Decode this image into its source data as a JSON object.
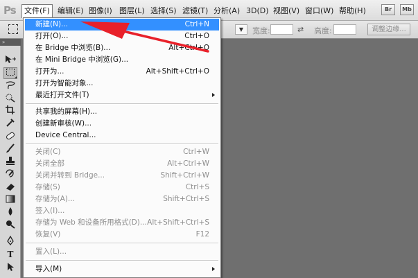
{
  "app": {
    "logo": "Ps"
  },
  "menubar": {
    "items": [
      {
        "label": "文件(F)"
      },
      {
        "label": "编辑(E)"
      },
      {
        "label": "图像(I)"
      },
      {
        "label": "图层(L)"
      },
      {
        "label": "选择(S)"
      },
      {
        "label": "滤镜(T)"
      },
      {
        "label": "分析(A)"
      },
      {
        "label": "3D(D)"
      },
      {
        "label": "视图(V)"
      },
      {
        "label": "窗口(W)"
      },
      {
        "label": "帮助(H)"
      }
    ],
    "bridge_button": "Br",
    "minibridge_button": "Mb"
  },
  "options_bar": {
    "width_label": "宽度:",
    "height_label": "高度:",
    "refine_edge_label": "调整边缘..."
  },
  "file_menu": {
    "groups": [
      [
        {
          "label": "新建(N)...",
          "shortcut": "Ctrl+N",
          "highlighted": true
        },
        {
          "label": "打开(O)...",
          "shortcut": "Ctrl+O"
        },
        {
          "label": "在 Bridge 中浏览(B)...",
          "shortcut": "Alt+Ctrl+O"
        },
        {
          "label": "在 Mini Bridge 中浏览(G)...",
          "shortcut": ""
        },
        {
          "label": "打开为...",
          "shortcut": "Alt+Shift+Ctrl+O"
        },
        {
          "label": "打开为智能对象...",
          "shortcut": ""
        },
        {
          "label": "最近打开文件(T)",
          "shortcut": "",
          "submenu": true
        }
      ],
      [
        {
          "label": "共享我的屏幕(H)...",
          "shortcut": ""
        },
        {
          "label": "创建新审核(W)...",
          "shortcut": ""
        },
        {
          "label": "Device Central...",
          "shortcut": ""
        }
      ],
      [
        {
          "label": "关闭(C)",
          "shortcut": "Ctrl+W",
          "disabled": true
        },
        {
          "label": "关闭全部",
          "shortcut": "Alt+Ctrl+W",
          "disabled": true
        },
        {
          "label": "关闭并转到 Bridge...",
          "shortcut": "Shift+Ctrl+W",
          "disabled": true
        },
        {
          "label": "存储(S)",
          "shortcut": "Ctrl+S",
          "disabled": true
        },
        {
          "label": "存储为(A)...",
          "shortcut": "Shift+Ctrl+S",
          "disabled": true
        },
        {
          "label": "签入(I)...",
          "shortcut": "",
          "disabled": true
        },
        {
          "label": "存储为 Web 和设备所用格式(D)...",
          "shortcut": "Alt+Shift+Ctrl+S",
          "disabled": true
        },
        {
          "label": "恢复(V)",
          "shortcut": "F12",
          "disabled": true
        }
      ],
      [
        {
          "label": "置入(L)...",
          "shortcut": "",
          "disabled": true
        }
      ],
      [
        {
          "label": "导入(M)",
          "shortcut": "",
          "submenu": true
        }
      ]
    ]
  },
  "annotation": {
    "arrow_color": "#e8212a"
  },
  "toolbar": {
    "tools": [
      {
        "name": "move-tool-icon"
      },
      {
        "name": "rectangular-marquee-tool-icon",
        "selected": true
      },
      {
        "name": "lasso-tool-icon"
      },
      {
        "name": "quick-selection-tool-icon"
      },
      {
        "name": "crop-tool-icon"
      },
      {
        "name": "eyedropper-tool-icon"
      },
      {
        "name": "spot-healing-brush-icon"
      },
      {
        "name": "brush-tool-icon"
      },
      {
        "name": "clone-stamp-tool-icon"
      },
      {
        "name": "history-brush-tool-icon"
      },
      {
        "name": "eraser-tool-icon"
      },
      {
        "name": "gradient-tool-icon"
      },
      {
        "name": "blur-tool-icon"
      },
      {
        "name": "dodge-tool-icon"
      },
      {
        "name": "pen-tool-icon"
      },
      {
        "name": "type-tool-icon"
      },
      {
        "name": "path-selection-tool-icon"
      }
    ]
  }
}
